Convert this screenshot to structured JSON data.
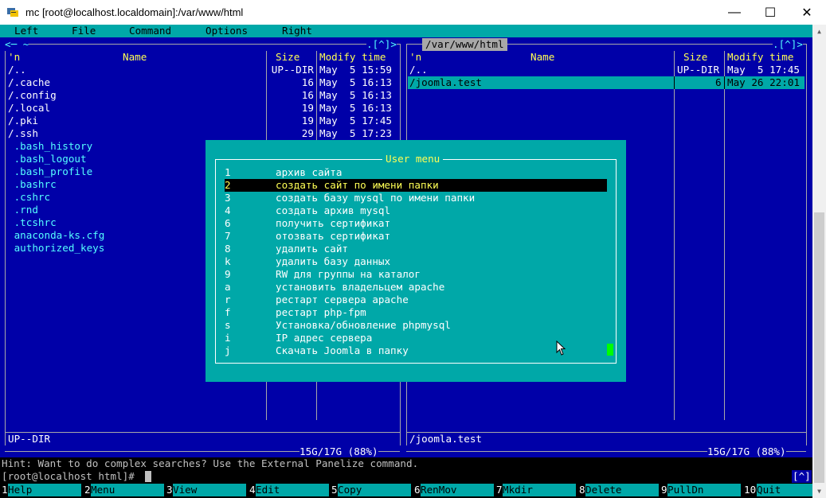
{
  "window": {
    "title": "mc [root@localhost.localdomain]:/var/www/html",
    "minimize": "—",
    "maximize": "☐",
    "close": "✕"
  },
  "menubar": [
    "Left",
    "File",
    "Command",
    "Options",
    "Right"
  ],
  "left_panel": {
    "top_left": "<─ ~",
    "top_right": ".[^]>",
    "col_n": "'n",
    "col_name": "Name",
    "col_size": "Size",
    "col_time": "Modify time",
    "rows": [
      {
        "name": "/..",
        "size": "UP--DIR",
        "time": "May  5 15:59",
        "dir": true
      },
      {
        "name": "/.cache",
        "size": "16",
        "time": "May  5 16:13",
        "dir": true
      },
      {
        "name": "/.config",
        "size": "16",
        "time": "May  5 16:13",
        "dir": true
      },
      {
        "name": "/.local",
        "size": "19",
        "time": "May  5 16:13",
        "dir": true
      },
      {
        "name": "/.pki",
        "size": "19",
        "time": "May  5 17:45",
        "dir": true
      },
      {
        "name": "/.ssh",
        "size": "29",
        "time": "May  5 17:23",
        "dir": true
      },
      {
        "name": " .bash_history",
        "size": "",
        "time": "",
        "dir": false
      },
      {
        "name": " .bash_logout",
        "size": "",
        "time": "",
        "dir": false
      },
      {
        "name": " .bash_profile",
        "size": "",
        "time": "",
        "dir": false
      },
      {
        "name": " .bashrc",
        "size": "",
        "time": "",
        "dir": false
      },
      {
        "name": " .cshrc",
        "size": "",
        "time": "",
        "dir": false
      },
      {
        "name": " .rnd",
        "size": "",
        "time": "",
        "dir": false
      },
      {
        "name": " .tcshrc",
        "size": "",
        "time": "",
        "dir": false
      },
      {
        "name": " anaconda-ks.cfg",
        "size": "",
        "time": "",
        "dir": false
      },
      {
        "name": " authorized_keys",
        "size": "",
        "time": "",
        "dir": false
      }
    ],
    "status": "UP--DIR",
    "disk": "15G/17G (88%)"
  },
  "right_panel": {
    "path": "/var/www/html",
    "top_right": ".[^]>",
    "col_n": "'n",
    "col_name": "Name",
    "col_size": "Size",
    "col_time": "Modify time",
    "rows": [
      {
        "name": "/..",
        "size": "UP--DIR",
        "time": "May  5 17:45"
      },
      {
        "name": "/joomla.test",
        "size": "6",
        "time": "May 26 22:01"
      }
    ],
    "status": "/joomla.test",
    "disk": "15G/17G (88%)"
  },
  "user_menu": {
    "title": "User menu",
    "items": [
      {
        "key": "1",
        "label": "архив сайта"
      },
      {
        "key": "2",
        "label": "создать сайт по имени папки"
      },
      {
        "key": "3",
        "label": "создать базу mysql по имени папки"
      },
      {
        "key": "4",
        "label": "создать архив mysql"
      },
      {
        "key": "6",
        "label": "получить сертификат"
      },
      {
        "key": "7",
        "label": "отозвать сертификат"
      },
      {
        "key": "8",
        "label": "удалить сайт"
      },
      {
        "key": "k",
        "label": "удалить базу данных"
      },
      {
        "key": "9",
        "label": "RW для группы на каталог"
      },
      {
        "key": "a",
        "label": "установить владельцем apache"
      },
      {
        "key": "r",
        "label": "рестарт сервера apache"
      },
      {
        "key": "f",
        "label": "рестарт php-fpm"
      },
      {
        "key": "s",
        "label": "Установка/обновление phpmysql"
      },
      {
        "key": "i",
        "label": "IP адрес сервера"
      },
      {
        "key": "j",
        "label": "Скачать Joomla в папку"
      }
    ]
  },
  "hint": "Hint: Want to do complex searches? Use the External Panelize command.",
  "prompt": "[root@localhost html]#",
  "prompt_right": "[^]",
  "fkeys": [
    {
      "num": "1",
      "label": "Help"
    },
    {
      "num": "2",
      "label": "Menu"
    },
    {
      "num": "3",
      "label": "View"
    },
    {
      "num": "4",
      "label": "Edit"
    },
    {
      "num": "5",
      "label": "Copy"
    },
    {
      "num": "6",
      "label": "RenMov"
    },
    {
      "num": "7",
      "label": "Mkdir"
    },
    {
      "num": "8",
      "label": "Delete"
    },
    {
      "num": "9",
      "label": "PullDn"
    },
    {
      "num": "10",
      "label": "Quit"
    }
  ]
}
